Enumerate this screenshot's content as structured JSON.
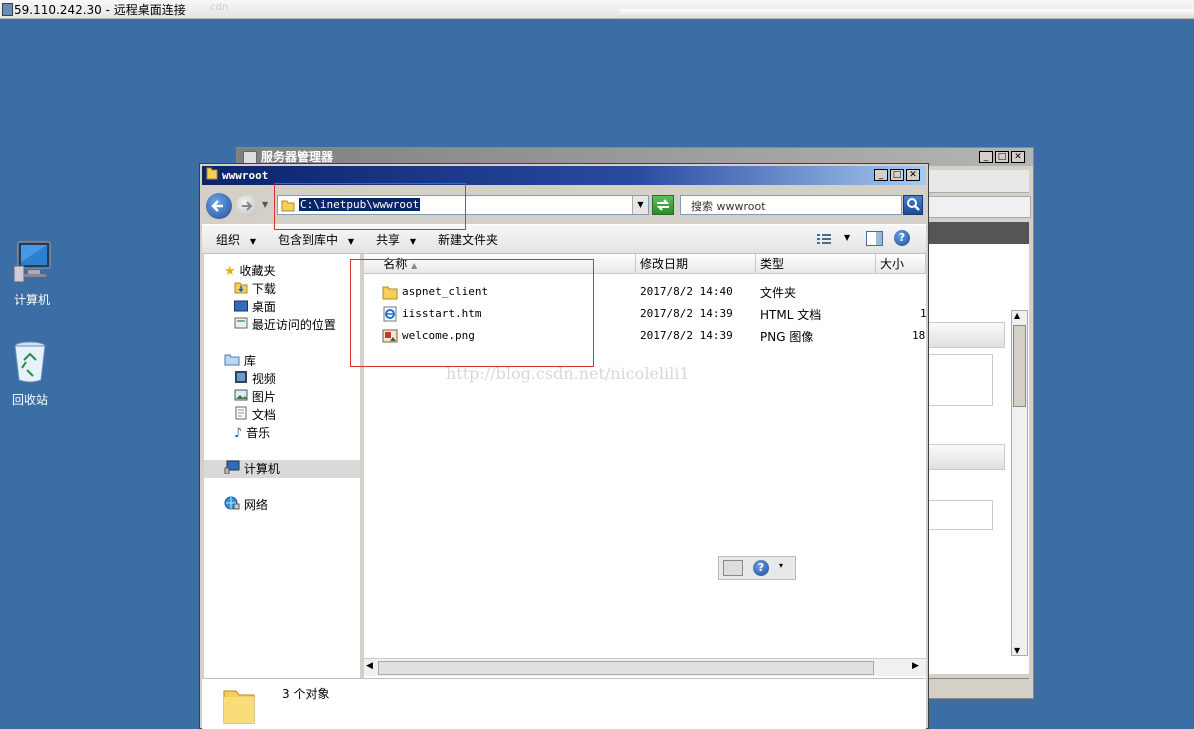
{
  "rdp": {
    "title": "59.110.242.30 - 远程桌面连接",
    "blur_text": "cdn"
  },
  "desktop": {
    "icons": [
      {
        "label": "计算机",
        "icon": "computer-icon"
      },
      {
        "label": "回收站",
        "icon": "recycle-bin-icon"
      }
    ]
  },
  "server_manager": {
    "title": "服务器管理器"
  },
  "explorer": {
    "title": "wwwroot",
    "address": "C:\\inetpub\\wwwroot",
    "search_placeholder": "搜索 wwwroot",
    "toolbar": {
      "organize": "组织",
      "include_in_library": "包含到库中",
      "share": "共享",
      "new_folder": "新建文件夹"
    },
    "nav": {
      "favorites": "收藏夹",
      "downloads": "下载",
      "desktop": "桌面",
      "recent": "最近访问的位置",
      "libraries": "库",
      "videos": "视频",
      "pictures": "图片",
      "documents": "文档",
      "music": "音乐",
      "computer": "计算机",
      "network": "网络"
    },
    "columns": {
      "name": "名称",
      "date": "修改日期",
      "type": "类型",
      "size": "大小"
    },
    "files": [
      {
        "name": "aspnet_client",
        "date": "2017/8/2 14:40",
        "type": "文件夹",
        "size": "",
        "icon": "folder-icon"
      },
      {
        "name": "iisstart.htm",
        "date": "2017/8/2 14:39",
        "type": "HTML 文档",
        "size": "1",
        "icon": "ie-document-icon"
      },
      {
        "name": "welcome.png",
        "date": "2017/8/2 14:39",
        "type": "PNG 图像",
        "size": "18",
        "icon": "image-file-icon"
      }
    ],
    "watermark": "http://blog.csdn.net/nicolelili1",
    "status": "3 个对象"
  },
  "colors": {
    "desktop": "#3b6ea5",
    "title_active": "#0a246a",
    "highlight_box": "#e03030"
  }
}
